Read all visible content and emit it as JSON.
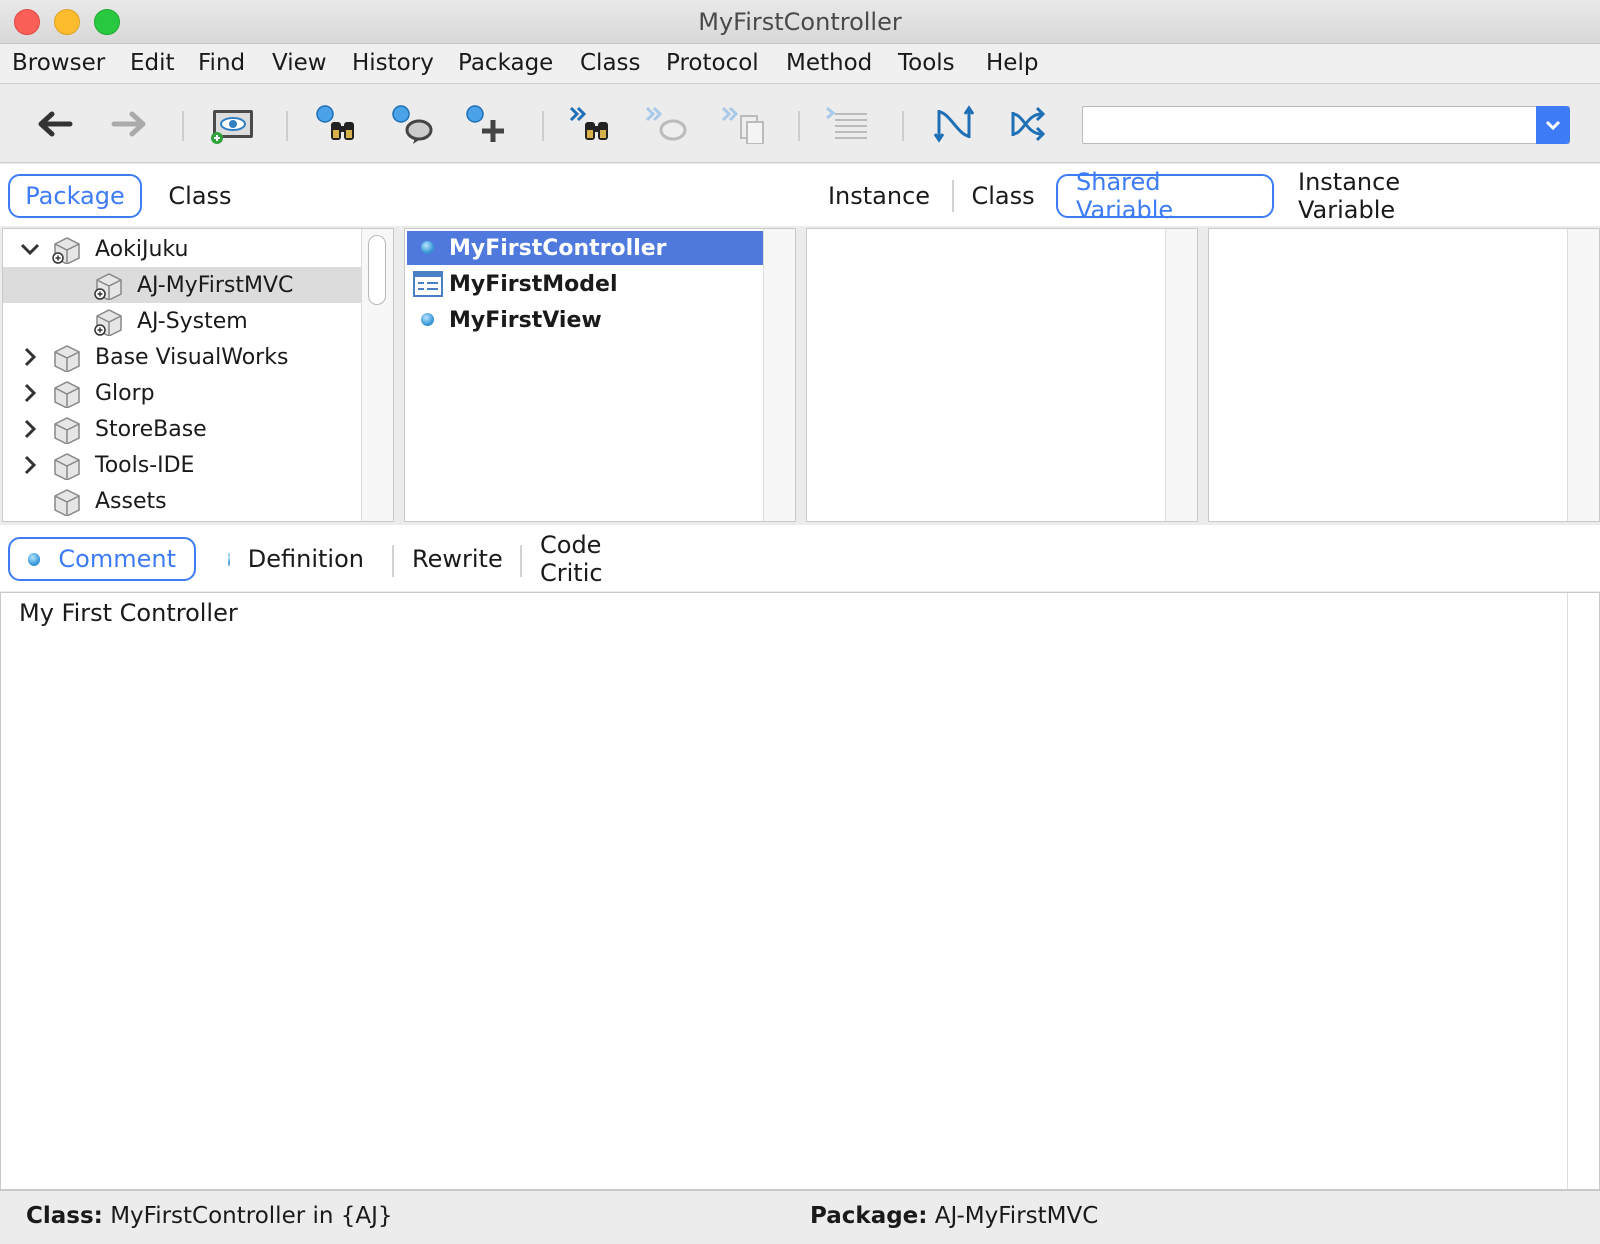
{
  "window": {
    "title": "MyFirstController"
  },
  "menu": [
    "Browser",
    "Edit",
    "Find",
    "View",
    "History",
    "Package",
    "Class",
    "Protocol",
    "Method",
    "Tools",
    "Help"
  ],
  "toolbar": {
    "search_value": "",
    "buttons": [
      "back-arrow-icon",
      "forward-arrow-icon",
      "visual-eye-icon",
      "find-binoculars-icon",
      "find-references-icon",
      "add-icon",
      "next-binoculars-icon",
      "next-references-icon",
      "next-copy-icon",
      "lines-icon",
      "sync-icon",
      "shuffle-icon"
    ]
  },
  "top_tabs": {
    "left": [
      "Package",
      "Class"
    ],
    "selected_left": "Package",
    "right": [
      "Instance",
      "Class",
      "Shared Variable",
      "Instance Variable"
    ],
    "selected_right": "Shared Variable"
  },
  "packages": [
    {
      "label": "AokiJuku",
      "expanded": true,
      "level": 0
    },
    {
      "label": "AJ-MyFirstMVC",
      "level": 1,
      "selected": true
    },
    {
      "label": "AJ-System",
      "level": 1
    },
    {
      "label": "Base VisualWorks",
      "collapsed": true,
      "level": 0
    },
    {
      "label": "Glorp",
      "collapsed": true,
      "level": 0
    },
    {
      "label": "StoreBase",
      "collapsed": true,
      "level": 0
    },
    {
      "label": "Tools-IDE",
      "collapsed": true,
      "level": 0
    },
    {
      "label": "Assets",
      "level": 0
    }
  ],
  "classes": [
    {
      "label": "MyFirstController",
      "selected": true
    },
    {
      "label": "MyFirstModel"
    },
    {
      "label": "MyFirstView"
    }
  ],
  "bottom_tabs": {
    "items": [
      "Comment",
      "Definition",
      "Rewrite",
      "Code Critic"
    ],
    "selected": "Comment"
  },
  "editor": {
    "text": "My First Controller"
  },
  "status": {
    "class_label": "Class:",
    "class_value": "MyFirstController in {AJ}",
    "package_label": "Package:",
    "package_value": "AJ-MyFirstMVC"
  },
  "colors": {
    "accent": "#3d7cf6",
    "selection": "#4f79dd"
  }
}
